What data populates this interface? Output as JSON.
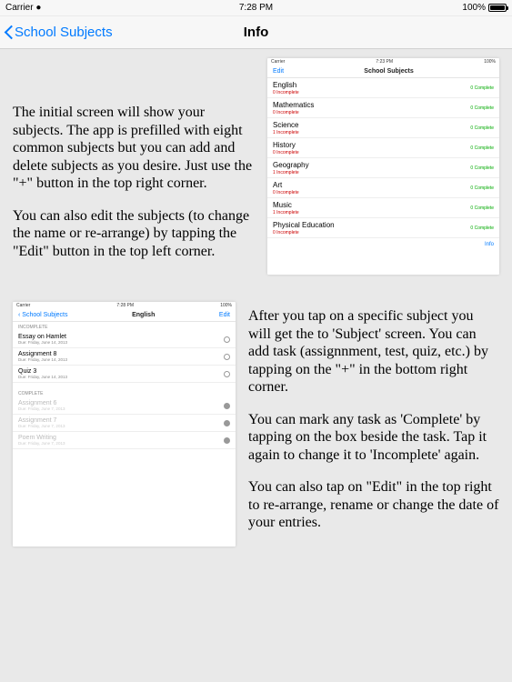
{
  "status": {
    "carrier": "Carrier",
    "time": "7:28 PM",
    "battery": "100%"
  },
  "nav": {
    "back_label": "School Subjects",
    "title": "Info"
  },
  "section1": {
    "para1": "The initial screen will show your subjects. The app is prefilled with eight common subjects but you can add and delete subjects as you desire. Just use the \"+\" button in the top right corner.",
    "para2": "You can also edit the subjects (to change the name or re-arrange) by tapping the \"Edit\" button in the top left corner."
  },
  "section2": {
    "para1": "After you tap on a specific subject you will get the to 'Subject' screen. You can add task (assignnment, test, quiz, etc.) by tapping on the \"+\" in the bottom right corner.",
    "para2": "You can mark any task as 'Complete' by tapping on the box beside the task. Tap it again to change it to 'Incomplete' again.",
    "para3": "You can also tap on \"Edit\" in the top right to re-arrange, rename or change the date of your entries."
  },
  "thumb1": {
    "status": {
      "left": "Carrier",
      "center": "7:23 PM",
      "right": "100%"
    },
    "nav": {
      "left": "Edit",
      "title": "School Subjects",
      "right": ""
    },
    "rows": [
      {
        "name": "English",
        "sub": "0 Incomplete",
        "right": "0 Complete"
      },
      {
        "name": "Mathematics",
        "sub": "0 Incomplete",
        "right": "0 Complete"
      },
      {
        "name": "Science",
        "sub": "1 Incomplete",
        "right": "0 Complete"
      },
      {
        "name": "History",
        "sub": "0 Incomplete",
        "right": "0 Complete"
      },
      {
        "name": "Geography",
        "sub": "1 Incomplete",
        "right": "0 Complete"
      },
      {
        "name": "Art",
        "sub": "0 Incomplete",
        "right": "0 Complete"
      },
      {
        "name": "Music",
        "sub": "1 Incomplete",
        "right": "0 Complete"
      },
      {
        "name": "Physical Education",
        "sub": "0 Incomplete",
        "right": "0 Complete"
      }
    ],
    "footer": "Info"
  },
  "thumb2": {
    "status": {
      "left": "Carrier",
      "center": "7:28 PM",
      "right": "100%"
    },
    "nav": {
      "left": "School Subjects",
      "title": "English",
      "right": "Edit"
    },
    "header1": "INCOMPLETE",
    "incomplete": [
      {
        "name": "Essay on Hamlet",
        "sub": "Due: Friday, June 14, 2013"
      },
      {
        "name": "Assignment 8",
        "sub": "Due: Friday, June 14, 2013"
      },
      {
        "name": "Quiz 3",
        "sub": "Due: Friday, June 14, 2013"
      }
    ],
    "header2": "COMPLETE",
    "complete": [
      {
        "name": "Assignment 6",
        "sub": "Due: Friday, June 7, 2013"
      },
      {
        "name": "Assignment 7",
        "sub": "Due: Friday, June 7, 2013"
      },
      {
        "name": "Poem Writing",
        "sub": "Due: Friday, June 7, 2013"
      }
    ]
  }
}
